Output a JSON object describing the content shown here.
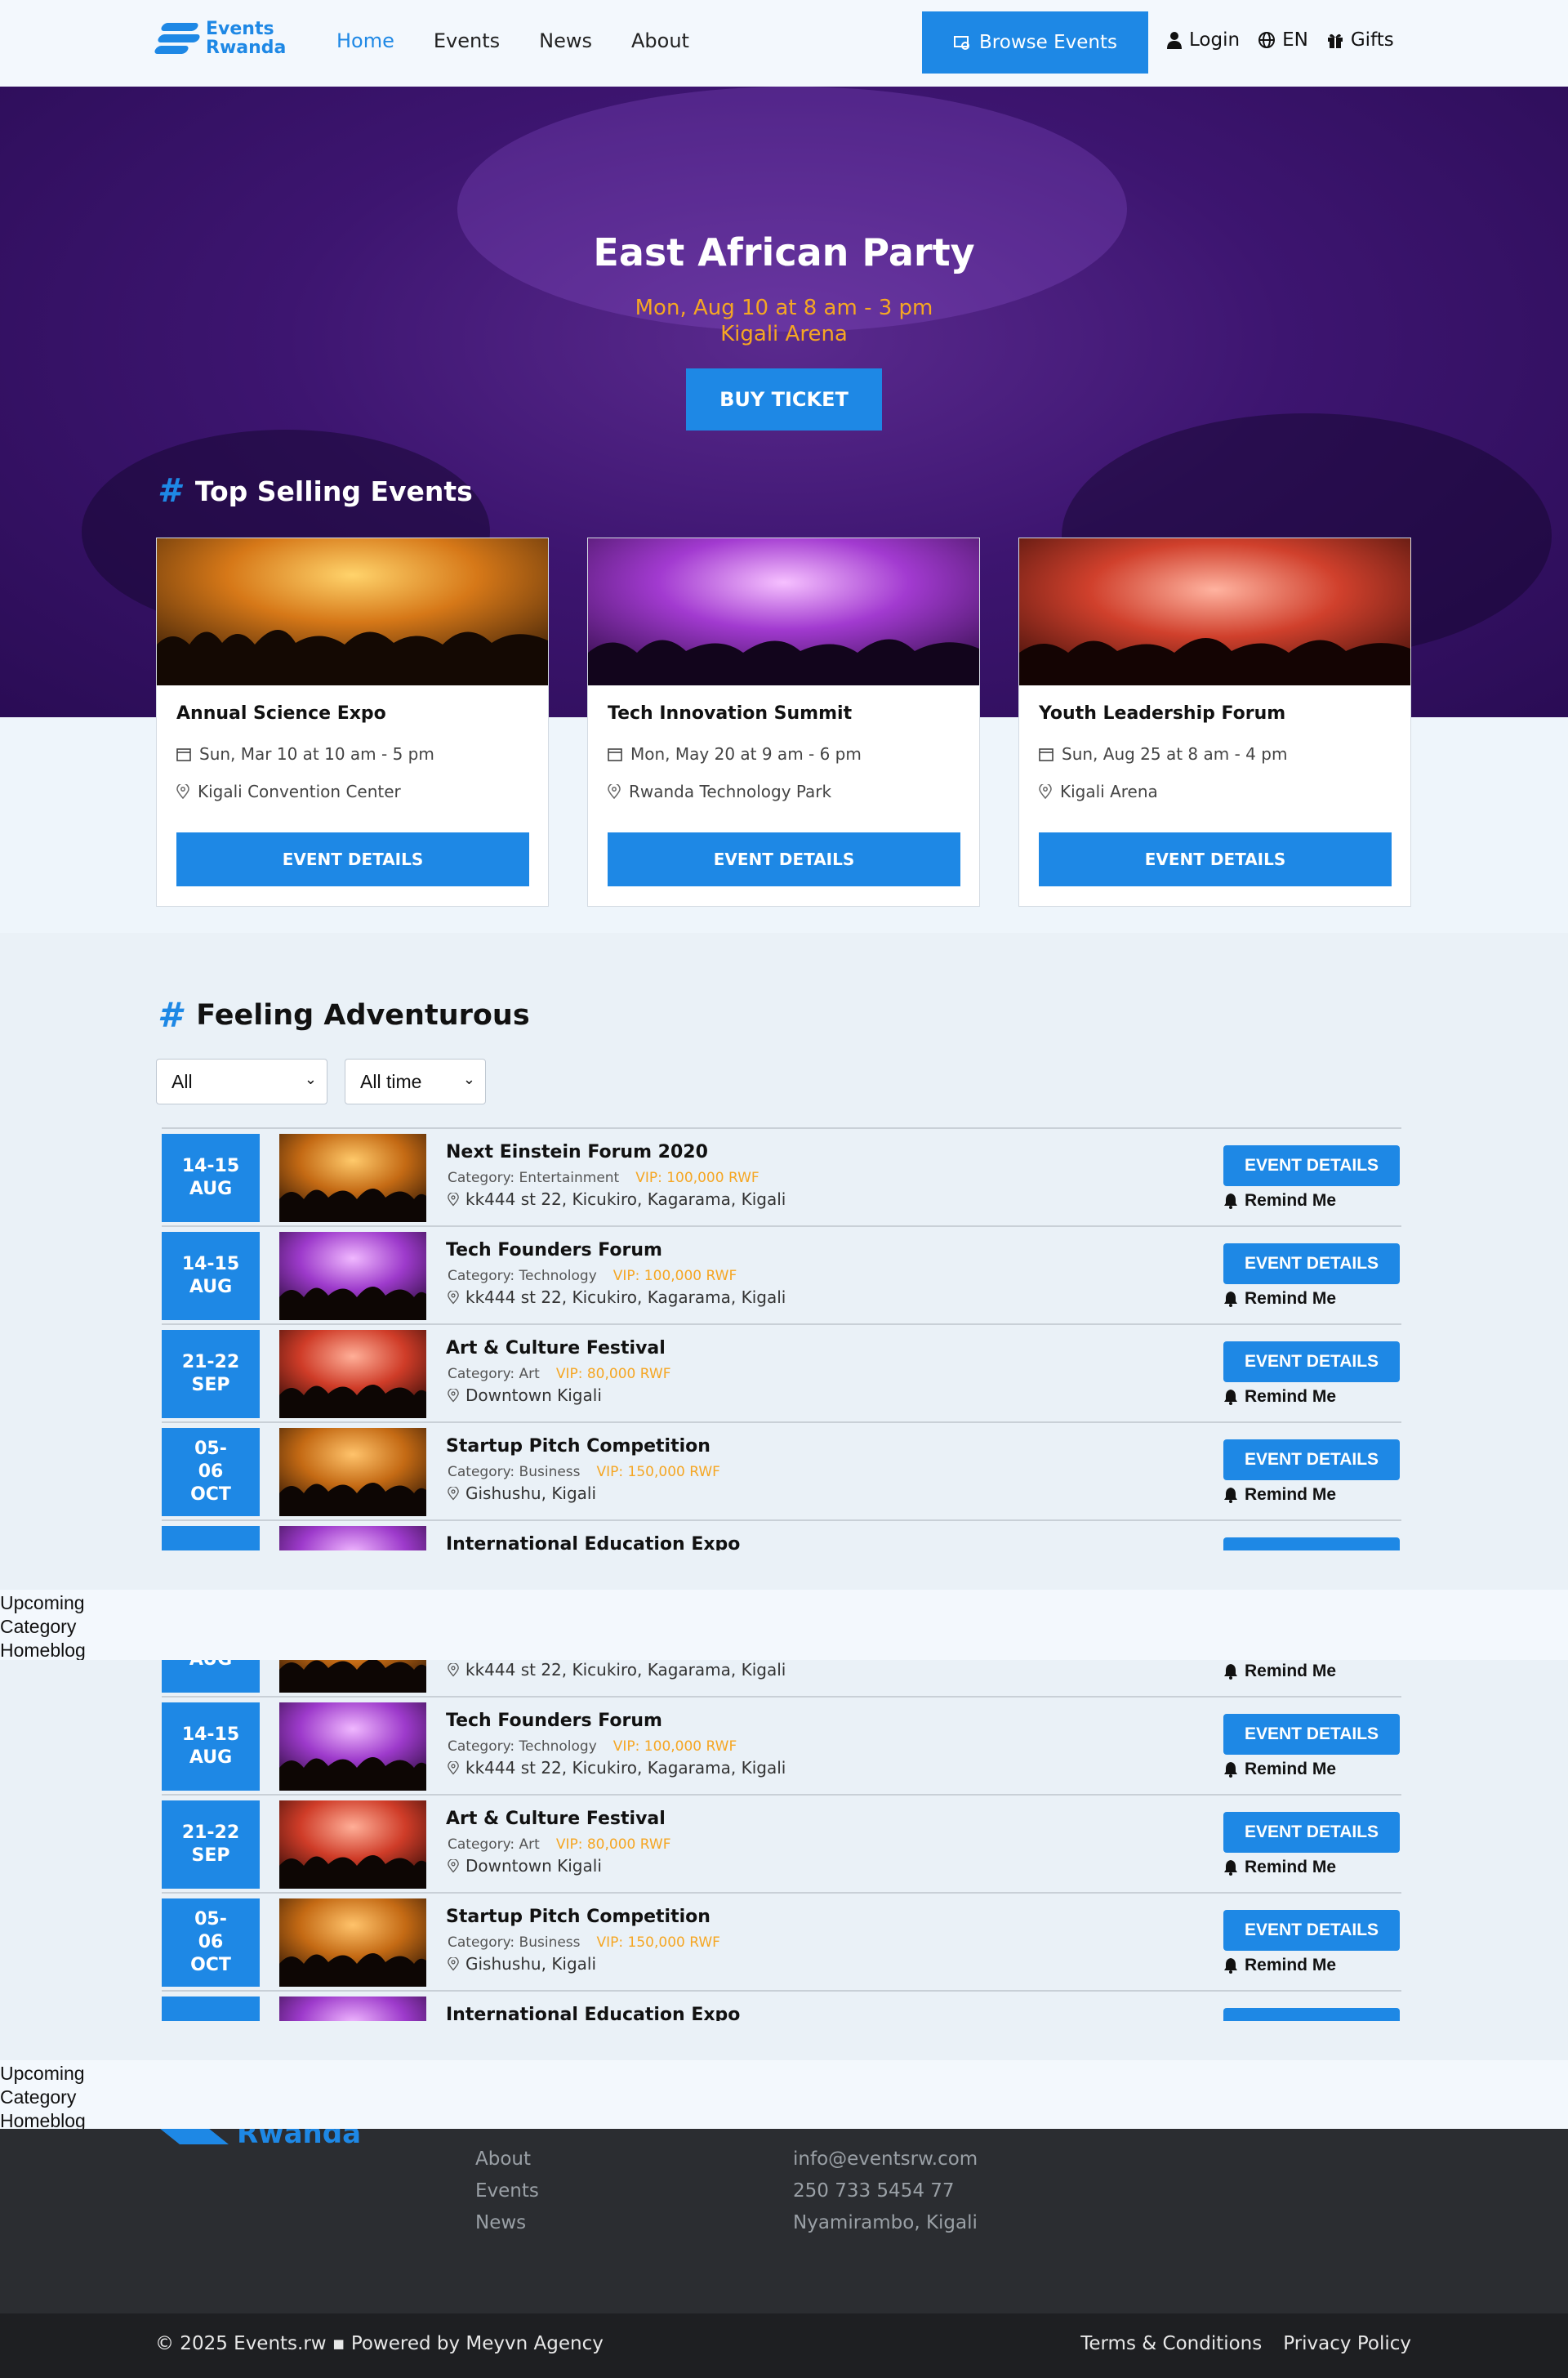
{
  "header": {
    "brand_line1": "Events",
    "brand_line2": "Rwanda",
    "nav": [
      "Home",
      "Events",
      "News",
      "About"
    ],
    "browse_label": "Browse Events",
    "login_label": "Login",
    "lang_label": "EN",
    "gifts_label": "Gifts"
  },
  "hero": {
    "title": "East African Party",
    "date": "Mon, Aug 10 at 8 am - 3 pm",
    "venue": "Kigali Arena",
    "button": "BUY TICKET"
  },
  "top_selling": {
    "title": "Top Selling Events",
    "button": "EVENT DETAILS",
    "cards": [
      {
        "title": "Annual Science Expo",
        "date": "Sun, Mar 10 at 10 am - 5 pm",
        "location": "Kigali Convention Center"
      },
      {
        "title": "Tech Innovation Summit",
        "date": "Mon, May 20 at 9 am - 6 pm",
        "location": "Rwanda Technology Park"
      },
      {
        "title": "Youth Leadership Forum",
        "date": "Sun, Aug 25 at 8 am - 4 pm",
        "location": "Kigali Arena"
      }
    ]
  },
  "adventurous": {
    "title": "Feeling Adventurous",
    "filter_category": "All",
    "filter_time": "All time",
    "button": "EVENT DETAILS",
    "remind": "Remind Me",
    "events": [
      {
        "d1": "14-15",
        "d2": "AUG",
        "d3": "",
        "title": "Next Einstein Forum 2020",
        "category": "Category: Entertainment",
        "vip": "VIP: 100,000 RWF",
        "location": "kk444 st 22, Kicukiro, Kagarama, Kigali"
      },
      {
        "d1": "14-15",
        "d2": "AUG",
        "d3": "",
        "title": "Tech Founders Forum",
        "category": "Category: Technology",
        "vip": "VIP: 100,000 RWF",
        "location": "kk444 st 22, Kicukiro, Kagarama, Kigali"
      },
      {
        "d1": "21-22",
        "d2": "SEP",
        "d3": "",
        "title": "Art & Culture Festival",
        "category": "Category: Art",
        "vip": "VIP: 80,000 RWF",
        "location": "Downtown Kigali"
      },
      {
        "d1": "05-",
        "d2": "06",
        "d3": "OCT",
        "title": "Startup Pitch Competition",
        "category": "Category: Business",
        "vip": "VIP: 150,000 RWF",
        "location": "Gishushu, Kigali"
      },
      {
        "d1": "",
        "d2": "",
        "d3": "",
        "title": "International Education Expo",
        "category": "",
        "vip": "",
        "location": ""
      }
    ]
  },
  "strip_links": [
    "Upcoming",
    "Category",
    "Homeblog"
  ],
  "footer": {
    "brand": "Rwanda",
    "links": [
      "About",
      "Events",
      "News"
    ],
    "contact": [
      "info@eventsrw.com",
      "250 733 5454 77",
      "Nyamirambo, Kigali"
    ],
    "copyright": "© 2025 Events.rw ▪ Powered by Meyvn Agency",
    "terms": "Terms & Conditions",
    "privacy": "Privacy Policy"
  },
  "colors": {
    "accent": "#1e88e5",
    "gold": "#f5a623",
    "hero": "#3d1570",
    "footer": "#2b2d31"
  }
}
